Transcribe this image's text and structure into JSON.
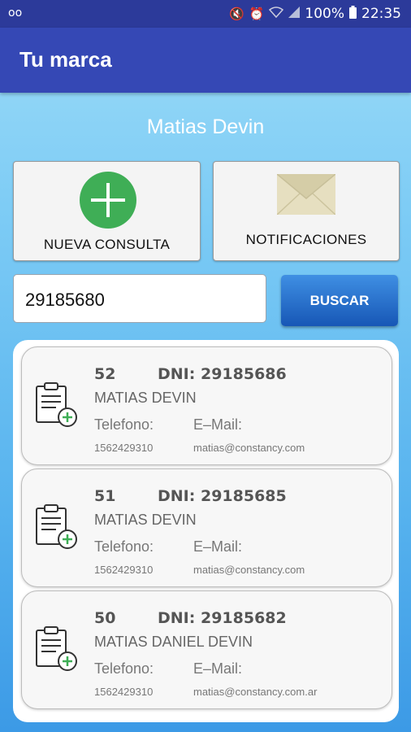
{
  "status_bar": {
    "voicemail": "oo",
    "battery": "100%",
    "time": "22:35"
  },
  "app_bar": {
    "title": "Tu marca"
  },
  "user": {
    "name": "Matias Devin"
  },
  "actions": {
    "new_query_label": "NUEVA CONSULTA",
    "notifications_label": "NOTIFICACIONES"
  },
  "search": {
    "value": "29185680",
    "button_label": "BUSCAR"
  },
  "results": [
    {
      "number": "52",
      "dni_label": "DNI:",
      "dni": "29185686",
      "name": "MATIAS DEVIN",
      "phone_label": "Telefono:",
      "email_label": "E–Mail:",
      "phone": "1562429310",
      "email": "matias@constancy.com"
    },
    {
      "number": "51",
      "dni_label": "DNI:",
      "dni": "29185685",
      "name": "MATIAS DEVIN",
      "phone_label": "Telefono:",
      "email_label": "E–Mail:",
      "phone": "1562429310",
      "email": "matias@constancy.com"
    },
    {
      "number": "50",
      "dni_label": "DNI:",
      "dni": "29185682",
      "name": "MATIAS DANIEL DEVIN",
      "phone_label": "Telefono:",
      "email_label": "E–Mail:",
      "phone": "1562429310",
      "email": "matias@constancy.com.ar"
    }
  ],
  "colors": {
    "status_bar": "#2c3a9a",
    "app_bar": "#3548b5",
    "plus_circle": "#3fae56",
    "search_button": "#1f6ccc"
  },
  "icons": {
    "new_query": "plus-circle-icon",
    "notifications": "envelope-icon",
    "result": "clipboard-add-icon"
  }
}
